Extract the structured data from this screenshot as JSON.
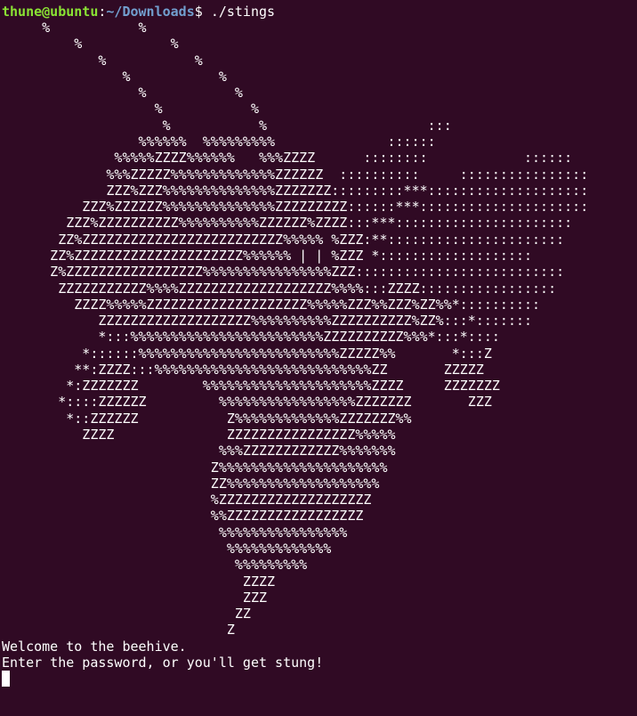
{
  "prompt": {
    "user_host": "thune@ubuntu",
    "separator": ":",
    "path": "~/Downloads",
    "symbol": "$ ",
    "command": "./stings"
  },
  "ascii_art": "     %           %\n         %           %\n            %           %\n               %           %\n                 %           %\n                   %           %\n                    %           %                    :::\n                 %%%%%%  %%%%%%%%%              ::::::\n              %%%%%ZZZZ%%%%%%   %%%ZZZZ      ::::::::            ::::::\n             %%%ZZZZZ%%%%%%%%%%%%%ZZZZZZ  ::::::::::     ::::::::::::::::\n             ZZZ%ZZZ%%%%%%%%%%%%%%ZZZZZZZ:::::::::***::::::::::::::::::::\n          ZZZ%ZZZZZZ%%%%%%%%%%%%%%ZZZZZZZZZ::::::***:::::::::::::::::::::\n        ZZZ%ZZZZZZZZZZ%%%%%%%%%%ZZZZZZ%ZZZZ:::***::::::::::::::::::::::\n       ZZ%ZZZZZZZZZZZZZZZZZZZZZZZZZ%%%%% %ZZZ:**::::::::::::::::::::::\n      ZZ%ZZZZZZZZZZZZZZZZZZZZZ%%%%%% | | %ZZZ *:::::::::::::::::::\n      Z%ZZZZZZZZZZZZZZZZZ%%%%%%%%%%%%%%%%ZZZ::::::::::::::::::::::::::\n       ZZZZZZZZZZZ%%%%ZZZZZZZZZZZZZZZZZZZ%%%%:::ZZZZ:::::::::::::::::\n         ZZZZ%%%%%ZZZZZZZZZZZZZZZZZZZZ%%%%%ZZZ%%ZZZ%ZZ%%*::::::::::\n            ZZZZZZZZZZZZZZZZZZZ%%%%%%%%%%ZZZZZZZZZZ%ZZ%:::*:::::::\n            *:::%%%%%%%%%%%%%%%%%%%%%%%%ZZZZZZZZZZ%%%*:::*::::\n          *::::::%%%%%%%%%%%%%%%%%%%%%%%%%ZZZZZ%%       *:::Z\n         **:ZZZZ:::%%%%%%%%%%%%%%%%%%%%%%%%%%%ZZ       ZZZZZ\n        *:ZZZZZZZ        %%%%%%%%%%%%%%%%%%%%%ZZZZ     ZZZZZZZ\n       *::::ZZZZZZ         %%%%%%%%%%%%%%%%%ZZZZZZZ       ZZZ\n        *::ZZZZZZ           Z%%%%%%%%%%%%%ZZZZZZZ%%\n          ZZZZ              ZZZZZZZZZZZZZZZZ%%%%%\n                           %%%ZZZZZZZZZZZZ%%%%%%%\n                          Z%%%%%%%%%%%%%%%%%%%%%\n                          ZZ%%%%%%%%%%%%%%%%%%%\n                          %ZZZZZZZZZZZZZZZZZZZ\n                          %%ZZZZZZZZZZZZZZZZZ\n                           %%%%%%%%%%%%%%%%\n                            %%%%%%%%%%%%%\n                             %%%%%%%%%\n                              ZZZZ\n                              ZZZ\n                             ZZ\n                            Z",
  "messages": {
    "welcome": "Welcome to the beehive.",
    "password_prompt": "Enter the password, or you'll get stung!"
  },
  "colors": {
    "background": "#300a24",
    "foreground": "#ffffff",
    "user_host": "#8ae234",
    "path": "#729fcf"
  }
}
